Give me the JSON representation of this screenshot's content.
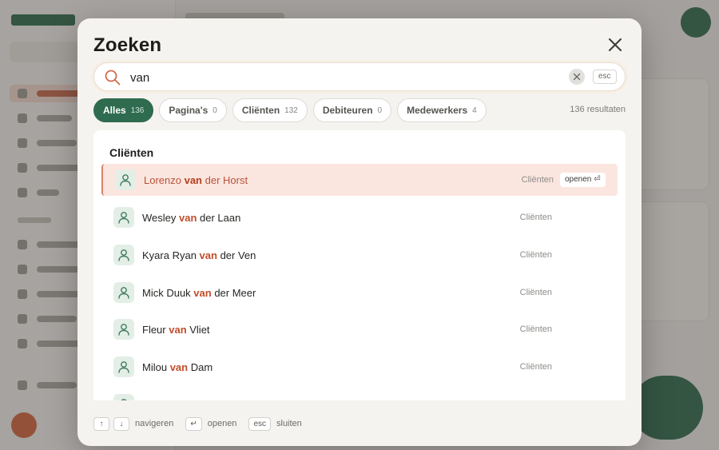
{
  "dialog": {
    "title": "Zoeken"
  },
  "search": {
    "value": "van",
    "esc_label": "esc"
  },
  "tabs": [
    {
      "label": "Alles",
      "count": "136",
      "active": true
    },
    {
      "label": "Pagina's",
      "count": "0",
      "active": false
    },
    {
      "label": "Cliënten",
      "count": "132",
      "active": false
    },
    {
      "label": "Debiteuren",
      "count": "0",
      "active": false
    },
    {
      "label": "Medewerkers",
      "count": "4",
      "active": false
    }
  ],
  "result_count": "136 resultaten",
  "results": {
    "group_title": "Cliënten",
    "open_label": "openen ⏎",
    "items": [
      {
        "before": "Lorenzo ",
        "match": "van",
        "after": " der Horst",
        "category": "Cliënten",
        "active": true
      },
      {
        "before": "Wesley ",
        "match": "van",
        "after": " der Laan",
        "category": "Cliënten",
        "active": false
      },
      {
        "before": "Kyara Ryan ",
        "match": "van",
        "after": " der Ven",
        "category": "Cliënten",
        "active": false
      },
      {
        "before": "Mick Duuk ",
        "match": "van",
        "after": " der Meer",
        "category": "Cliënten",
        "active": false
      },
      {
        "before": "Fleur ",
        "match": "van",
        "after": " Vliet",
        "category": "Cliënten",
        "active": false
      },
      {
        "before": "Milou ",
        "match": "van",
        "after": " Dam",
        "category": "Cliënten",
        "active": false
      }
    ]
  },
  "footer": {
    "up_key": "↑",
    "down_key": "↓",
    "navigate_label": "navigeren",
    "enter_key": "↵",
    "open_label": "openen",
    "esc_key": "esc",
    "close_label": "sluiten"
  },
  "colors": {
    "brand_green": "#2f6b4f",
    "highlight": "#c24d2c",
    "active_row_bg": "#fbe6df"
  },
  "icons": {
    "close": "close-icon",
    "search": "search-icon",
    "clear": "clear-icon",
    "client": "user-icon"
  }
}
